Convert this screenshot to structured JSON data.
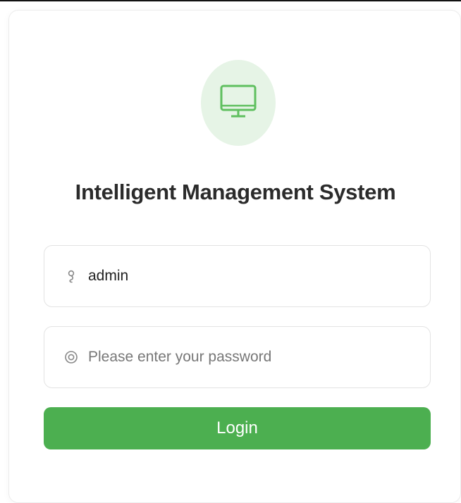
{
  "page": {
    "title": "Intelligent Management System",
    "logo_icon": "monitor-icon"
  },
  "form": {
    "username": {
      "icon": "user-icon",
      "value": "admin",
      "placeholder": ""
    },
    "password": {
      "icon": "lock-icon",
      "value": "",
      "placeholder": "Please enter your password"
    },
    "login_label": "Login"
  },
  "colors": {
    "accent": "#4caf50",
    "logo_bg": "#e6f4e6",
    "title": "#2b2b2b"
  }
}
